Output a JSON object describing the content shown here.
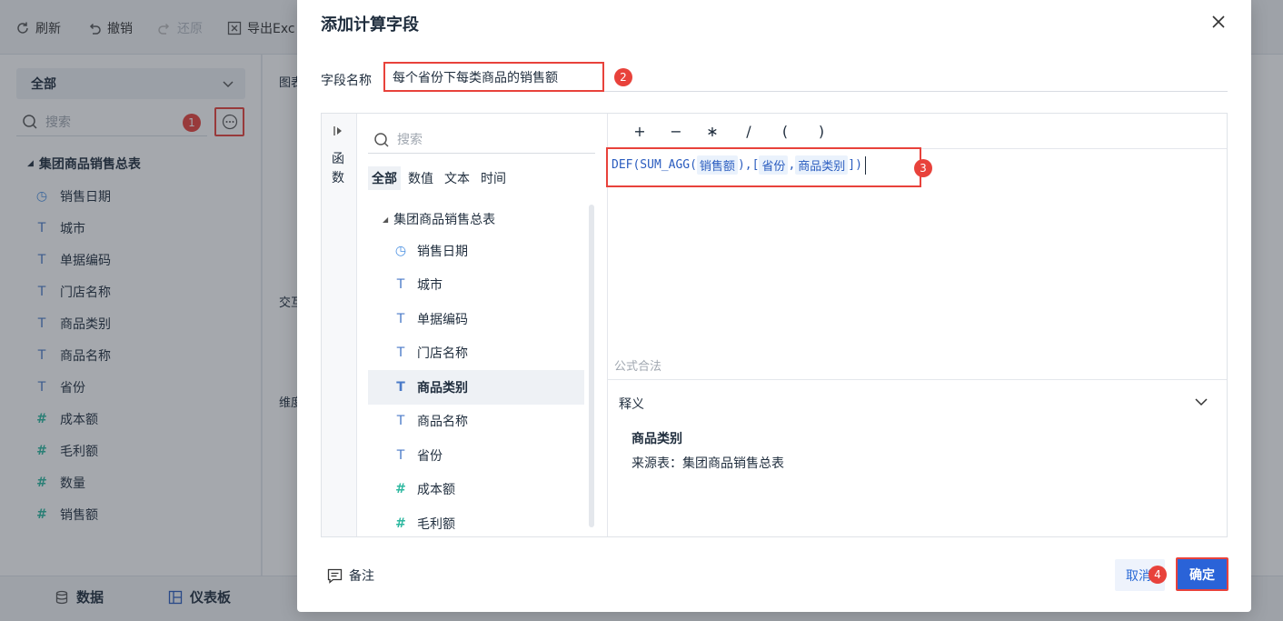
{
  "toolbar": {
    "refresh": "刷新",
    "undo": "撤销",
    "redo": "还原",
    "export": "导出Exc"
  },
  "left_panel": {
    "scope": "全部",
    "search_placeholder": "搜索",
    "table_name": "集团商品销售总表",
    "fields": [
      {
        "name": "销售日期",
        "type": "date"
      },
      {
        "name": "城市",
        "type": "text"
      },
      {
        "name": "单据编码",
        "type": "text"
      },
      {
        "name": "门店名称",
        "type": "text"
      },
      {
        "name": "商品类别",
        "type": "text"
      },
      {
        "name": "商品名称",
        "type": "text"
      },
      {
        "name": "省份",
        "type": "text"
      },
      {
        "name": "成本额",
        "type": "number"
      },
      {
        "name": "毛利额",
        "type": "number"
      },
      {
        "name": "数量",
        "type": "number"
      },
      {
        "name": "销售额",
        "type": "number"
      }
    ]
  },
  "mid_panel": {
    "label1": "图表",
    "label2": "交互",
    "label3": "维度"
  },
  "bottom_tabs": {
    "data": "数据",
    "dashboard": "仪表板"
  },
  "badges": [
    "1",
    "2",
    "3",
    "4"
  ],
  "dialog": {
    "title": "添加计算字段",
    "field_name_label": "字段名称",
    "field_name_value": "每个省份下每类商品的销售额",
    "func_rail_label": "函数",
    "field_search_placeholder": "搜索",
    "tabs": [
      "全部",
      "数值",
      "文本",
      "时间"
    ],
    "table_name": "集团商品销售总表",
    "fields": [
      {
        "name": "销售日期",
        "type": "date"
      },
      {
        "name": "城市",
        "type": "text"
      },
      {
        "name": "单据编码",
        "type": "text"
      },
      {
        "name": "门店名称",
        "type": "text"
      },
      {
        "name": "商品类别",
        "type": "text"
      },
      {
        "name": "商品名称",
        "type": "text"
      },
      {
        "name": "省份",
        "type": "text"
      },
      {
        "name": "成本额",
        "type": "number"
      },
      {
        "name": "毛利额",
        "type": "number"
      }
    ],
    "selected_field": "商品类别",
    "operators": [
      "+",
      "−",
      "∗",
      "/",
      "(",
      ")"
    ],
    "formula": {
      "prefix": "DEF(SUM_AGG(",
      "arg1": "销售额",
      "mid": "),[",
      "arg2": "省份",
      "comma": ",",
      "arg3": "商品类别",
      "suffix": "])"
    },
    "syntax_status": "公式合法",
    "definition": {
      "title": "释义",
      "field": "商品类别",
      "source": "来源表：集团商品销售总表"
    },
    "note_label": "备注",
    "cancel_label": "取消",
    "ok_label": "确定"
  }
}
